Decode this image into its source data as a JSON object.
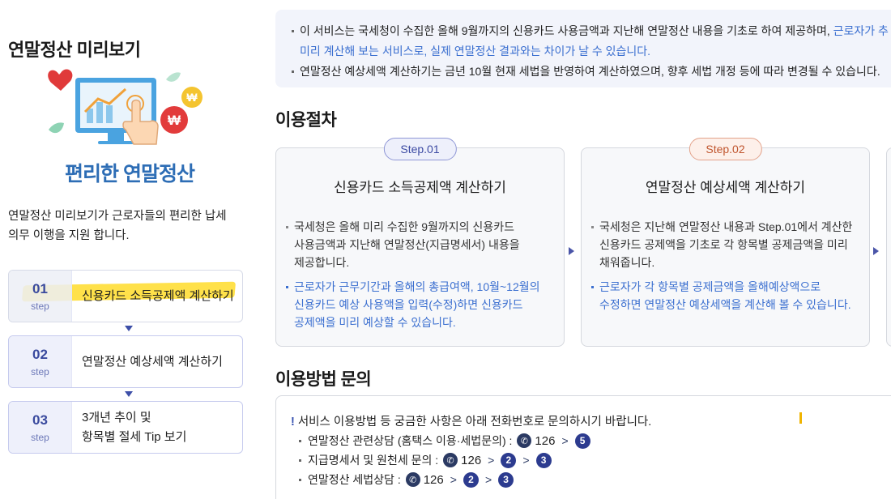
{
  "sidebar": {
    "title": "연말정산 미리보기",
    "hero_title": "편리한 연말정산",
    "intro_line1": "연말정산 미리보기가 근로자들의  편리한 납세",
    "intro_line2": "의무 이행을 지원 합니다.",
    "steps": [
      {
        "num": "01",
        "step": "step",
        "label": "신용카드 소득공제액 계산하기",
        "label2": ""
      },
      {
        "num": "02",
        "step": "step",
        "label": "연말정산 예상세액 계산하기",
        "label2": ""
      },
      {
        "num": "03",
        "step": "step",
        "label": "3개년 추이 및",
        "label2": "항목별 절세 Tip 보기"
      }
    ]
  },
  "notice": {
    "line1_text": "이 서비스는 국세청이 수집한 올해 9월까지의 신용카드 사용금액과 지난해 연말정산 내용을 기초로 하여 제공하며,",
    "line1_blue": " 근로자가 추",
    "line2_blue": "미리 계산해 보는 서비스로, 실제 연말정산 결과와는 차이가 날 수 있습니다.",
    "line3_text": "연말정산 예상세액 계산하기는 금년 10월 현재 세법을 반영하여 계산하였으며, 향후 세법 개정 등에 따라 변경될 수 있습니다."
  },
  "procedure": {
    "title": "이용절차",
    "cards": [
      {
        "pill": "Step.01",
        "title": "신용카드 소득공제액 계산하기",
        "p1": [
          "국세청은 올해 미리 수집한 9월까지의 신용카드",
          "사용금액과 지난해 연말정산(지급명세서) 내용을",
          "제공합니다."
        ],
        "p2": [
          "근로자가 근무기간과 올해의 총급여액, 10월~12월의",
          "신용카드 예상 사용액을 입력(수정)하면 신용카드",
          "공제액을 미리 예상할 수 있습니다."
        ]
      },
      {
        "pill": "Step.02",
        "title": "연말정산 예상세액 계산하기",
        "p1": [
          "국세청은 지난해 연말정산 내용과 Step.01에서 계산한",
          "신용카드 공제액을 기초로 각 항목별 공제금액을 미리",
          "채워줍니다."
        ],
        "p2": [
          "근로자가 각 항목별 공제금액을 올해예상액으로",
          "수정하면 연말정산 예상세액을 계산해 볼 수 있습니다."
        ]
      }
    ]
  },
  "inquiry": {
    "title": "이용방법 문의",
    "mark": "!",
    "head": "서비스 이용방법 등 궁금한 사항은 아래 전화번호로 문의하시기 바랍니다.",
    "rows": [
      {
        "label": "연말정산 관련상담 (홈택스 이용·세법문의) :",
        "num": "126",
        "opts": [
          "5"
        ]
      },
      {
        "label": "지급명세서 및 원천세 문의 :",
        "num": "126",
        "opts": [
          "2",
          "3"
        ]
      },
      {
        "label": "연말정산 세법상담 :",
        "num": "126",
        "opts": [
          "2",
          "3"
        ]
      }
    ],
    "chevron": ">"
  },
  "colors": {
    "accent": "#3b6fd0",
    "step_border": "#c6cbee",
    "hero": "#2d6db5",
    "step2": "#c0552e"
  },
  "icons": [
    "phone-icon",
    "heart-icon",
    "won-coin-icon",
    "monitor-chart-icon",
    "hand-pointer-icon",
    "triangle-down-icon",
    "triangle-right-icon"
  ]
}
